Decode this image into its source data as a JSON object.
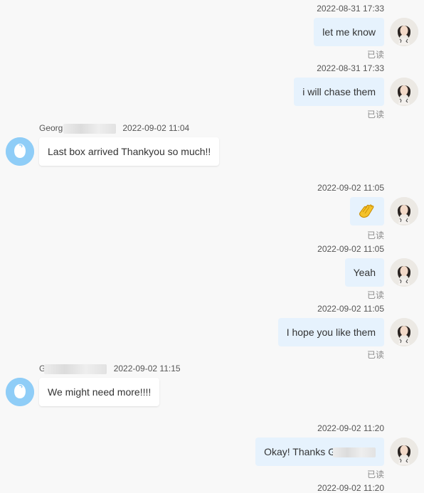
{
  "messages": [
    {
      "time": "2022-08-31 17:33",
      "text": "let me know",
      "status": "已读"
    },
    {
      "time": "2022-08-31 17:33",
      "text": "i will chase them",
      "status": "已读"
    },
    {
      "sender": "Georgi",
      "time": "2022-09-02 11:04",
      "text": "Last box arrived Thankyou so much!!"
    },
    {
      "time": "2022-09-02 11:05",
      "emoji": "clapping-hands-emoji",
      "status": "已读"
    },
    {
      "time": "2022-09-02 11:05",
      "text": "Yeah",
      "status": "已读"
    },
    {
      "time": "2022-09-02 11:05",
      "text": "I hope you like them",
      "status": "已读"
    },
    {
      "sender": "G",
      "time": "2022-09-02 11:15",
      "text": "We might need more!!!!"
    },
    {
      "time": "2022-09-02 11:20",
      "text": "Okay! Thanks G",
      "status": "已读"
    },
    {
      "time": "2022-09-02 11:20"
    }
  ],
  "colors": {
    "page_bg": "#f8f8f8",
    "outgoing_bubble": "#e6f2fd",
    "incoming_bubble": "#ffffff",
    "contact_avatar": "#8fcdf7"
  }
}
